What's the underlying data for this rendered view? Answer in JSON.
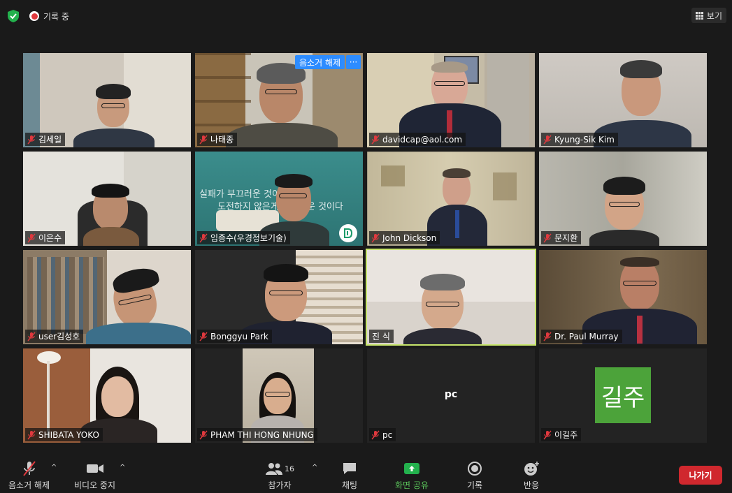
{
  "topbar": {
    "recording_label": "기록 중",
    "view_label": "보기"
  },
  "spotlight_chip": {
    "unmute_label": "음소거 해제",
    "more_label": "···"
  },
  "participants": [
    {
      "name": "김세일"
    },
    {
      "name": "나태종"
    },
    {
      "name": "davidcap@aol.com"
    },
    {
      "name": "Kyung-Sik Kim"
    },
    {
      "name": "이은수"
    },
    {
      "name": "임종수(우경정보기술)"
    },
    {
      "name": "John Dickson"
    },
    {
      "name": "문지환"
    },
    {
      "name": "user김성호"
    },
    {
      "name": "Bonggyu Park"
    },
    {
      "name": "진 식"
    },
    {
      "name": "Dr. Paul Murray"
    },
    {
      "name": "SHIBATA YOKO"
    },
    {
      "name": "PHAM THI HONG NHUNG"
    },
    {
      "name": "pc",
      "center_label": "pc"
    },
    {
      "name": "이길주",
      "avatar_text": "길주",
      "avatar_color": "#4ca33a"
    }
  ],
  "background_text": {
    "line1": "실패가 부끄러운 것이 아니라",
    "line2": "도전하지 않은게 부끄러운 것이다"
  },
  "toolbar": {
    "mute_label": "음소거 해제",
    "video_label": "비디오 중지",
    "participants_label": "참가자",
    "participants_count": "16",
    "chat_label": "채팅",
    "share_label": "화면 공유",
    "record_label": "기록",
    "reactions_label": "반응",
    "leave_label": "나가기"
  },
  "colors": {
    "share_green": "#5ac45a",
    "leave_red": "#d0282e",
    "active_speaker": "#c7e56b",
    "chip_blue": "#2d8cff"
  }
}
